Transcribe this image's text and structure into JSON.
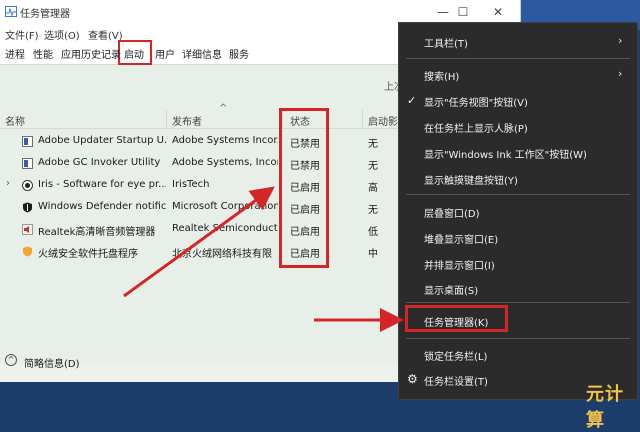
{
  "window": {
    "title": "任务管理器",
    "controls": {
      "minimize": "—",
      "maximize": "☐",
      "close": "✕"
    }
  },
  "menubar": [
    "文件(F)",
    "选项(O)",
    "查看(V)"
  ],
  "tabs": [
    "进程",
    "性能",
    "应用历史记录",
    "启动",
    "用户",
    "详细信息",
    "服务"
  ],
  "active_tab": "启动",
  "last_bios_partial": "上次",
  "columns": {
    "name": "名称",
    "publisher": "发布者",
    "status": "状态",
    "impact": "启动影"
  },
  "startup_items": [
    {
      "name": "Adobe Updater Startup U...",
      "publisher": "Adobe Systems Incor...",
      "status": "已禁用",
      "impact": "无",
      "icon": "adobe-icon",
      "expandable": false
    },
    {
      "name": "Adobe GC Invoker Utility",
      "publisher": "Adobe Systems, Incor...",
      "status": "已禁用",
      "impact": "无",
      "icon": "adobe-icon",
      "expandable": false
    },
    {
      "name": "Iris - Software for eye pr...",
      "publisher": "IrisTech",
      "status": "已启用",
      "impact": "高",
      "icon": "iris-icon",
      "expandable": true
    },
    {
      "name": "Windows Defender notific...",
      "publisher": "Microsoft Corporation",
      "status": "已启用",
      "impact": "无",
      "icon": "shield-icon",
      "expandable": false
    },
    {
      "name": "Realtek高清晰音频管理器",
      "publisher": "Realtek Semiconductor",
      "status": "已启用",
      "impact": "低",
      "icon": "speaker-icon",
      "expandable": false
    },
    {
      "name": "火绒安全软件托盘程序",
      "publisher": "北京火绒网络科技有限",
      "status": "已启用",
      "impact": "中",
      "icon": "shield-icon",
      "expandable": false
    }
  ],
  "footer": {
    "fewer_details": "简略信息(D)"
  },
  "context_menu": {
    "items": [
      {
        "label": "工具栏(T)",
        "submenu": true
      },
      {
        "label": "搜索(H)",
        "submenu": true
      },
      {
        "label": "显示\"任务视图\"按钮(V)",
        "checked": true
      },
      {
        "label": "在任务栏上显示人脉(P)"
      },
      {
        "label": "显示\"Windows Ink 工作区\"按钮(W)"
      },
      {
        "label": "显示触摸键盘按钮(Y)"
      },
      {
        "label": "层叠窗口(D)"
      },
      {
        "label": "堆叠显示窗口(E)"
      },
      {
        "label": "并排显示窗口(I)"
      },
      {
        "label": "显示桌面(S)"
      },
      {
        "label": "任务管理器(K)",
        "highlighted": true
      },
      {
        "label": "锁定任务栏(L)"
      },
      {
        "label": "任务栏设置(T)"
      }
    ]
  },
  "watermark": "元计算",
  "colors": {
    "annotation": "#d42626",
    "menu_bg": "#2b2b2b",
    "window_bg": "#eef1ee"
  }
}
